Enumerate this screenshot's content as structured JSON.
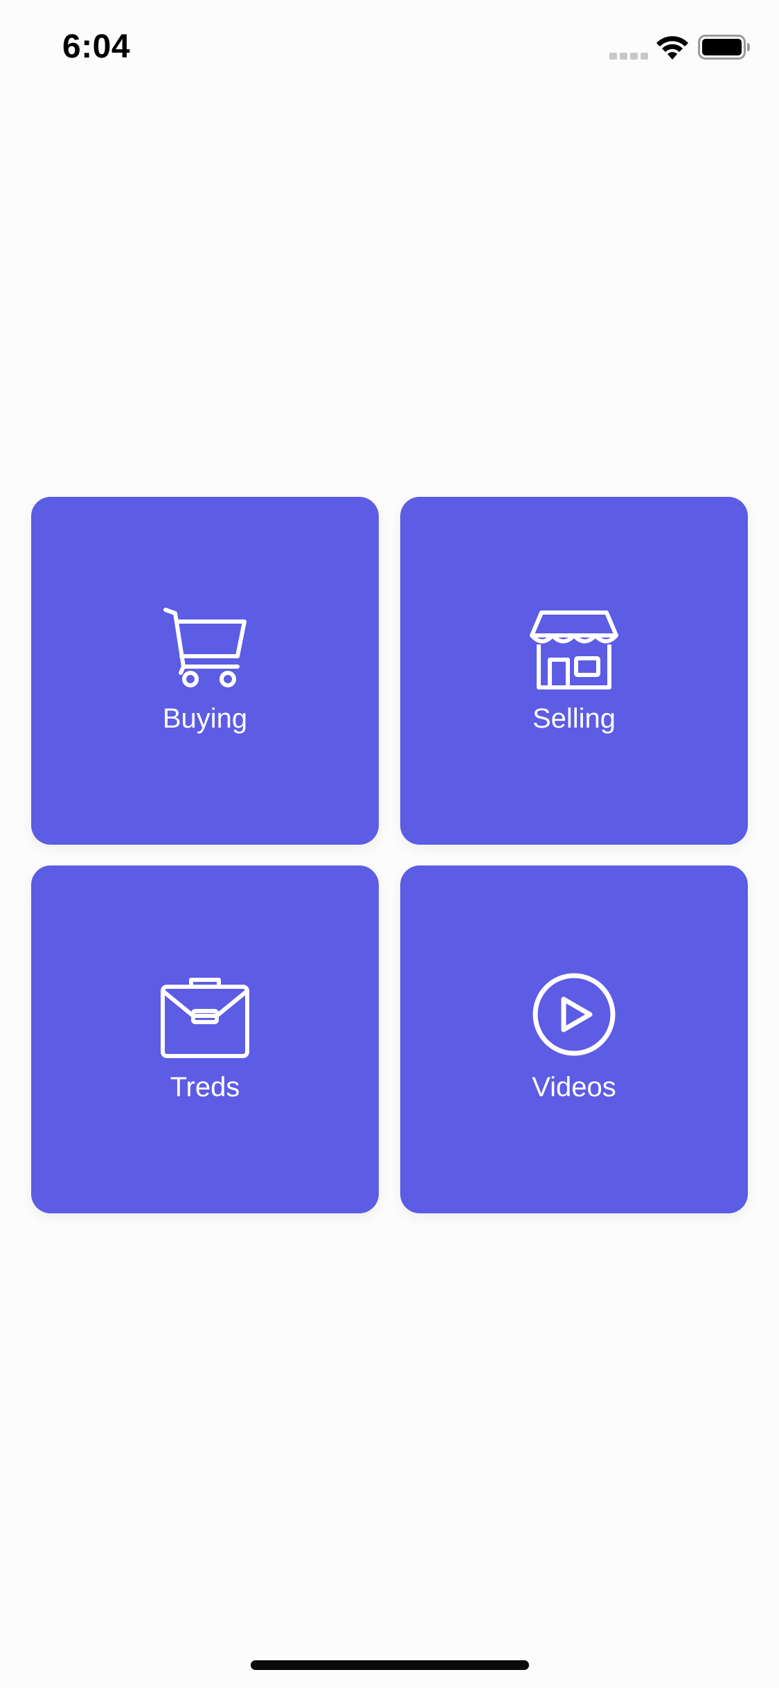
{
  "status_bar": {
    "time": "6:04",
    "icons": [
      "cellular-signal-icon",
      "wifi-icon",
      "battery-icon"
    ]
  },
  "colors": {
    "tile_background": "#5c5ce4",
    "tile_foreground": "#ffffff",
    "page_background": "#fcfcfc"
  },
  "tiles": [
    {
      "label": "Buying",
      "icon": "shopping-cart-icon"
    },
    {
      "label": "Selling",
      "icon": "storefront-icon"
    },
    {
      "label": "Treds",
      "icon": "briefcase-icon"
    },
    {
      "label": "Videos",
      "icon": "play-circle-icon"
    }
  ]
}
